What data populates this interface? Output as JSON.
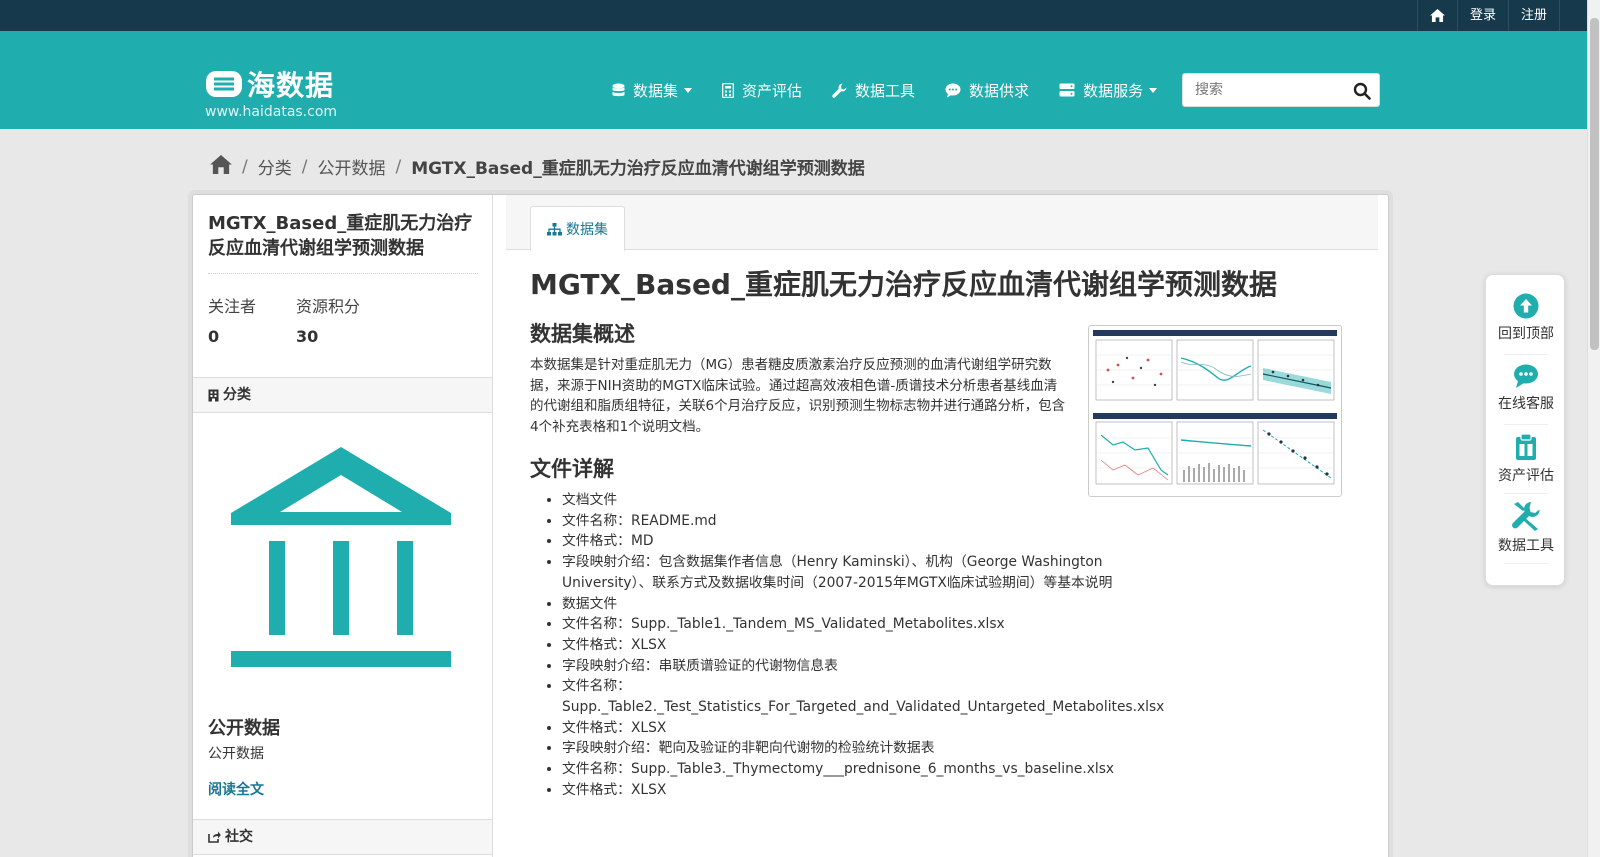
{
  "topbar": {
    "login": "登录",
    "register": "注册"
  },
  "brand": {
    "name": "海数据",
    "url": "www.haidatas.com"
  },
  "nav": {
    "items": [
      {
        "label": "数据集"
      },
      {
        "label": "资产评估"
      },
      {
        "label": "数据工具"
      },
      {
        "label": "数据供求"
      },
      {
        "label": "数据服务"
      }
    ]
  },
  "search": {
    "placeholder": "搜索"
  },
  "breadcrumb": {
    "category": "分类",
    "section": "公开数据",
    "current": "MGTX_Based_重症肌无力治疗反应血清代谢组学预测数据"
  },
  "aside": {
    "title": "MGTX_Based_重症肌无力治疗反应血清代谢组学预测数据",
    "followers_label": "关注者",
    "followers_value": "0",
    "points_label": "资源积分",
    "points_value": "30",
    "category_heading": "分类",
    "org_name": "公开数据",
    "org_desc": "公开数据",
    "read_more": "阅读全文",
    "social_heading": "社交"
  },
  "tabs": {
    "dataset": "数据集"
  },
  "content": {
    "title": "MGTX_Based_重症肌无力治疗反应血清代谢组学预测数据",
    "overview_heading": "数据集概述",
    "overview": "本数据集是针对重症肌无力（MG）患者糖皮质激素治疗反应预测的血清代谢组学研究数据，来源于NIH资助的MGTX临床试验。通过超高效液相色谱-质谱技术分析患者基线血清的代谢组和脂质组特征，关联6个月治疗反应，识别预测生物标志物并进行通路分析，包含4个补充表格和1个说明文档。",
    "files_heading": "文件详解",
    "files": [
      "文档文件",
      "文件名称：README.md",
      "文件格式：MD",
      "字段映射介绍：包含数据集作者信息（Henry Kaminski）、机构（George Washington University）、联系方式及数据收集时间（2007-2015年MGTX临床试验期间）等基本说明",
      "数据文件",
      "文件名称：Supp._Table1._Tandem_MS_Validated_Metabolites.xlsx",
      "文件格式：XLSX",
      "字段映射介绍：串联质谱验证的代谢物信息表",
      "文件名称：Supp._Table2._Test_Statistics_For_Targeted_and_Validated_Untargeted_Metabolites.xlsx",
      "文件格式：XLSX",
      "字段映射介绍：靶向及验证的非靶向代谢物的检验统计数据表",
      "文件名称：Supp._Table3._Thymectomy___prednisone_6_months_vs_baseline.xlsx",
      "文件格式：XLSX"
    ]
  },
  "float_tools": {
    "back_to_top": "回到顶部",
    "online_service": "在线客服",
    "asset_eval": "资产评估",
    "data_tools": "数据工具"
  },
  "colors": {
    "teal": "#1fadad",
    "navy": "#16394c",
    "link": "#187794"
  }
}
